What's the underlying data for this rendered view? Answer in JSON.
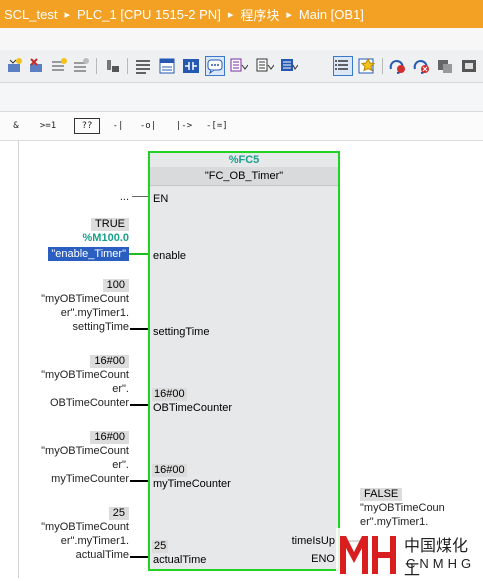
{
  "breadcrumb": [
    "SCL_test",
    "PLC_1 [CPU 1515-2 PN]",
    "程序块",
    "Main [OB1]"
  ],
  "toolbar1_icons": [
    "insert-network-icon",
    "delete-network-icon",
    "insert-row-icon",
    "add-row-icon",
    "reset-icon",
    "network-layout-icon",
    "block-interface-icon",
    "contact-blue-icon",
    "comment-toggle-icon",
    "absolute-address-icon",
    "symbol-info-icon",
    "address-format-icon",
    "favorites-list-icon",
    "favorites-star-icon",
    "monitor-on-icon",
    "monitor-off-icon",
    "compare-icon",
    "download-icon"
  ],
  "toolbar2": [
    {
      "icon": "and-box-icon",
      "label": "&"
    },
    {
      "icon": "ge-compare-icon",
      "label": ">=1"
    },
    {
      "icon": "empty-box-icon",
      "label": "??"
    },
    {
      "icon": "no-contact-icon",
      "label": "-|"
    },
    {
      "icon": "nc-contact-icon",
      "label": "-o|"
    },
    {
      "icon": "assignment-icon",
      "label": "|->"
    },
    {
      "icon": "coil-icon",
      "label": "-[=]"
    }
  ],
  "block": {
    "number": "%FC5",
    "name": "\"FC_OB_Timer\"",
    "en_input": "...",
    "pins_in": [
      {
        "name": "EN"
      },
      {
        "name": "enable",
        "monitor_value": "TRUE",
        "address": "%M100.0",
        "operand": "\"enable_Timer\""
      },
      {
        "name": "settingTime",
        "monitor_value": "100",
        "operand_lines": [
          "\"myOBTimeCount",
          "er\".myTimer1.",
          "settingTime"
        ]
      },
      {
        "name": "OBTimeCounter",
        "pin_value": "16#00",
        "monitor_value": "16#00",
        "operand_lines": [
          "\"myOBTimeCount",
          "er\".",
          "OBTimeCounter"
        ]
      },
      {
        "name": "myTimeCounter",
        "pin_value": "16#00",
        "monitor_value": "16#00",
        "operand_lines": [
          "\"myOBTimeCount",
          "er\".",
          "myTimeCounter"
        ]
      },
      {
        "name": "actualTime",
        "pin_value": "25",
        "monitor_value": "25",
        "operand_lines": [
          "\"myOBTimeCount",
          "er\".myTimer1.",
          "actualTime"
        ]
      }
    ],
    "pins_out": [
      {
        "name": "timeIsUp",
        "monitor_value": "FALSE",
        "operand_lines": [
          "\"myOBTimeCoun",
          "er\".myTimer1."
        ]
      },
      {
        "name": "ENO"
      }
    ]
  },
  "watermark": {
    "logo_text": "MH",
    "cn_text": "中国煤化工",
    "en_text": "CNMHG"
  },
  "colors": {
    "breadcrumb_bg": "#f2a125",
    "block_border": "#22d222",
    "selection": "#2a5fc1",
    "address_green": "#1aa08a"
  }
}
